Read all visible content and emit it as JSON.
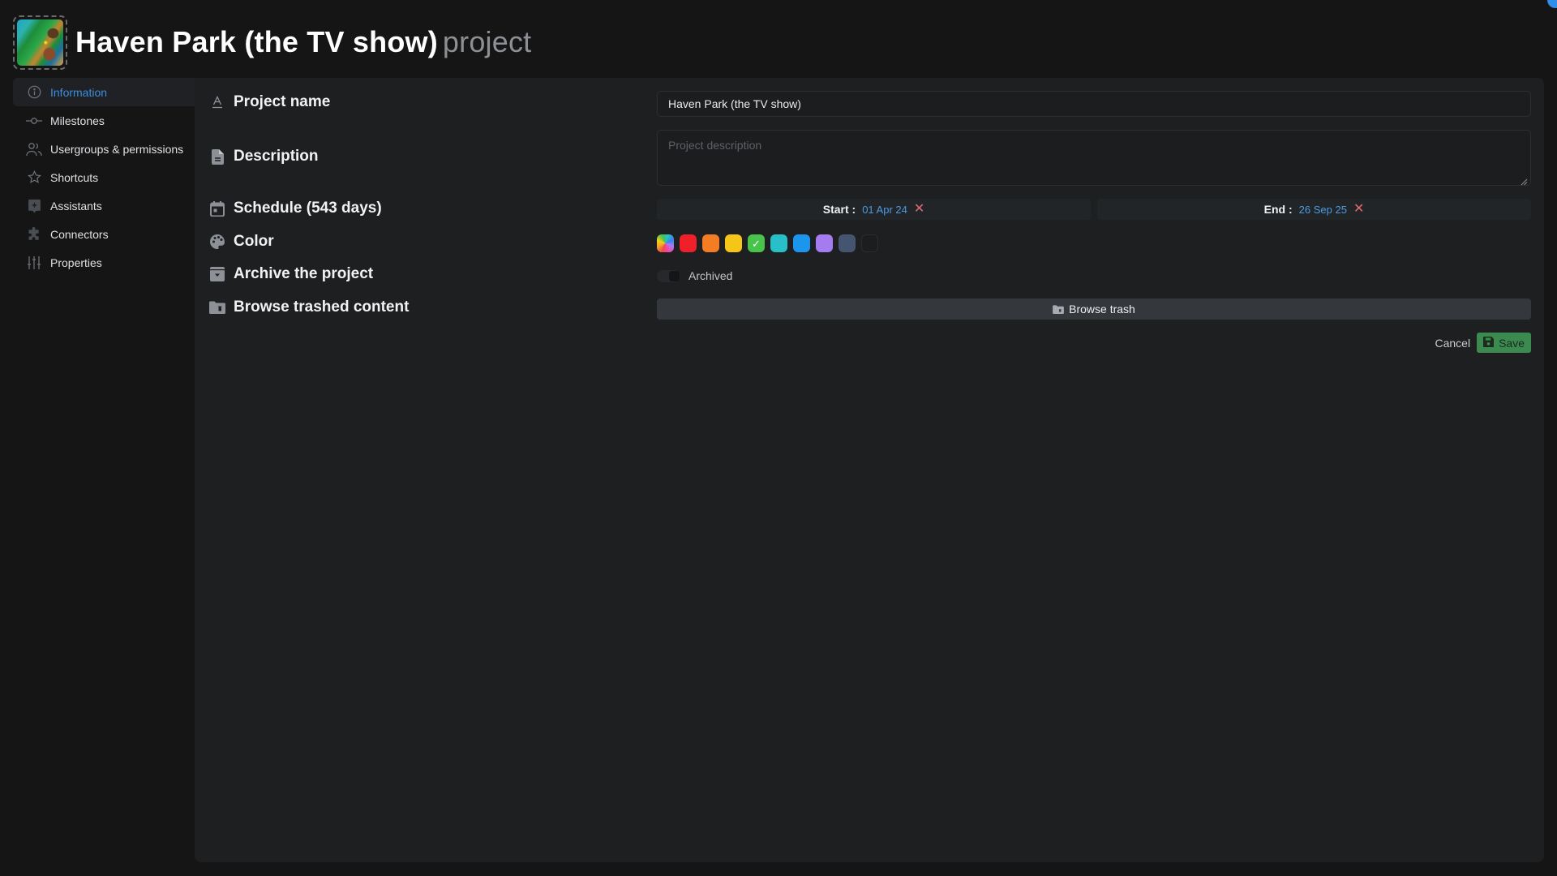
{
  "header": {
    "project_name": "Haven Park (the TV show)",
    "suffix": "project",
    "thumbnail_icon": "project-thumbnail"
  },
  "sidebar": {
    "items": [
      {
        "label": "Information",
        "icon": "info-circle-icon",
        "active": true
      },
      {
        "label": "Milestones",
        "icon": "milestone-icon",
        "active": false
      },
      {
        "label": "Usergroups & permissions",
        "icon": "users-icon",
        "active": false
      },
      {
        "label": "Shortcuts",
        "icon": "star-icon",
        "active": false
      },
      {
        "label": "Assistants",
        "icon": "assistant-icon",
        "active": false
      },
      {
        "label": "Connectors",
        "icon": "puzzle-icon",
        "active": false
      },
      {
        "label": "Properties",
        "icon": "sliders-icon",
        "active": false
      }
    ]
  },
  "form": {
    "project_name": {
      "label": "Project name",
      "value": "Haven Park (the TV show)"
    },
    "description": {
      "label": "Description",
      "placeholder": "Project description",
      "value": ""
    },
    "schedule": {
      "label": "Schedule (543 days)",
      "start_label": "Start :",
      "start_value": "01 Apr 24",
      "end_label": "End :",
      "end_value": "26 Sep 25",
      "clear_glyph": "✕"
    },
    "color": {
      "label": "Color",
      "swatches": [
        {
          "name": "rainbow",
          "color": "conic",
          "selected": false
        },
        {
          "name": "red",
          "color": "#f0202a",
          "selected": false
        },
        {
          "name": "orange",
          "color": "#f47c22",
          "selected": false
        },
        {
          "name": "yellow",
          "color": "#f5c518",
          "selected": false
        },
        {
          "name": "green",
          "color": "#48c44a",
          "selected": true
        },
        {
          "name": "teal",
          "color": "#28c0c8",
          "selected": false
        },
        {
          "name": "blue",
          "color": "#1c95ee",
          "selected": false
        },
        {
          "name": "purple",
          "color": "#a57cf0",
          "selected": false
        },
        {
          "name": "slate",
          "color": "#46556f",
          "selected": false
        },
        {
          "name": "none",
          "color": "#1c1d1f",
          "selected": false
        }
      ],
      "check_glyph": "✓"
    },
    "archive": {
      "label": "Archive the project",
      "toggle_label": "Archived",
      "checked": false
    },
    "trash": {
      "label": "Browse trashed content",
      "button_label": "Browse trash"
    }
  },
  "actions": {
    "cancel_label": "Cancel",
    "save_label": "Save"
  },
  "colors": {
    "accent": "#3a8ee0",
    "save_green": "#3b8a4f",
    "clear_red": "#e26b6b"
  }
}
